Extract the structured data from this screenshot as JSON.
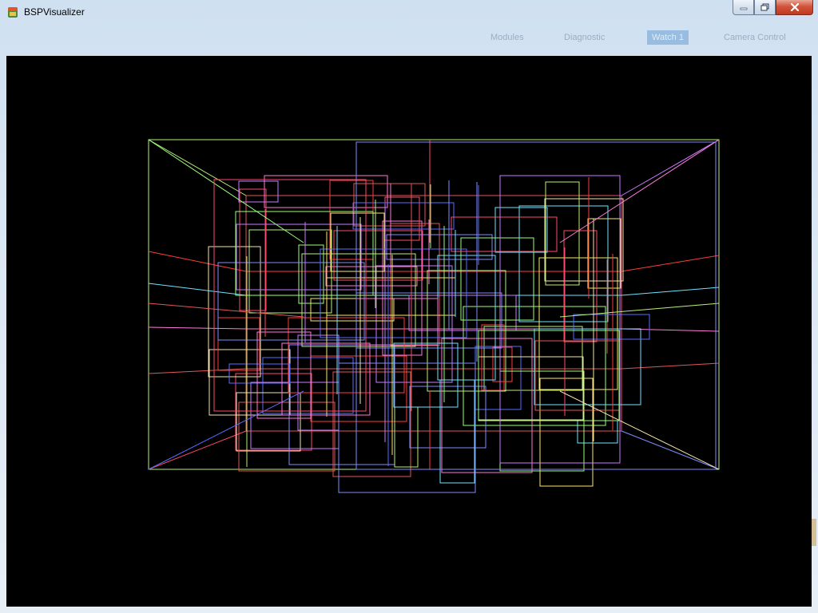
{
  "window": {
    "title": "BSPVisualizer",
    "icon": "bsp-app-icon",
    "buttons": {
      "minimize": "minimize-icon",
      "maximize": "restore-icon",
      "close": "close-icon"
    }
  },
  "background_app": {
    "tabs": [
      "Modules",
      "Diagnostic",
      "Watch 1",
      "Camera Control"
    ]
  },
  "scene": {
    "type": "wireframe BSP nodes",
    "background_color": "#000000",
    "edge_colors": [
      "#b9f07a",
      "#ff4a6a",
      "#ff3b3b",
      "#7f8cff",
      "#c87cff",
      "#6fe3ff",
      "#ffe66b",
      "#9dff7a",
      "#ff7ad9",
      "#5a6bff",
      "#f5e3a8",
      "#e05858"
    ]
  }
}
